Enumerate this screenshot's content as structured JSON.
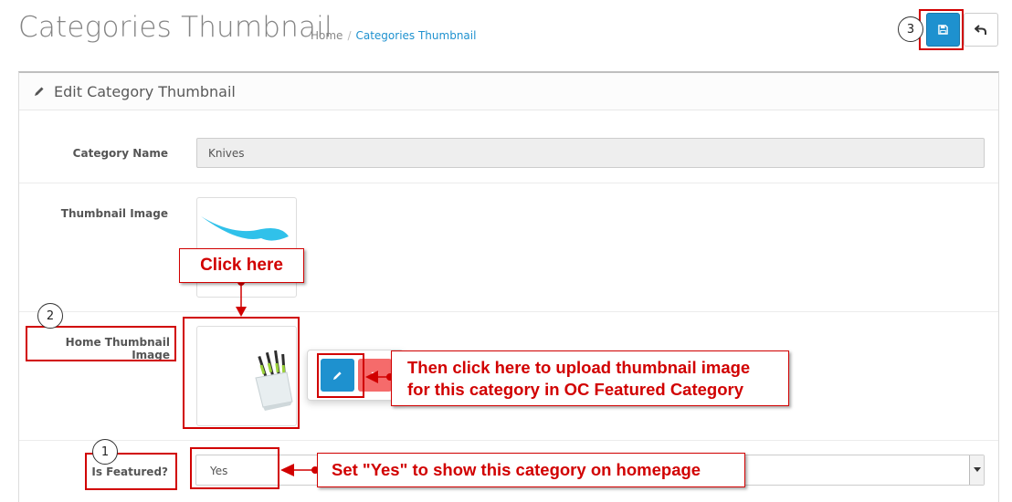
{
  "header": {
    "page_title": "Categories Thumbnail",
    "breadcrumb": [
      "Home",
      "Categories Thumbnail"
    ]
  },
  "toolbar": {
    "save_icon": "save-icon",
    "back_icon": "reply-icon"
  },
  "panel": {
    "title": "Edit Category Thumbnail",
    "title_icon": "pencil-icon"
  },
  "form": {
    "category_name_label": "Category Name",
    "category_name_value": "Knives",
    "thumbnail_label": "Thumbnail Image",
    "home_thumbnail_label": "Home Thumbnail Image",
    "is_featured_label": "Is Featured?",
    "is_featured_value": "Yes"
  },
  "annotations": {
    "click_here": "Click here",
    "upload_line1": "Then click here to upload thumbnail image",
    "upload_line2": "for this category in OC Featured Category",
    "featured_hint": "Set \"Yes\" to show this category on homepage",
    "step1": "1",
    "step2": "2",
    "step3": "3",
    "accent_color": "#d10000"
  }
}
